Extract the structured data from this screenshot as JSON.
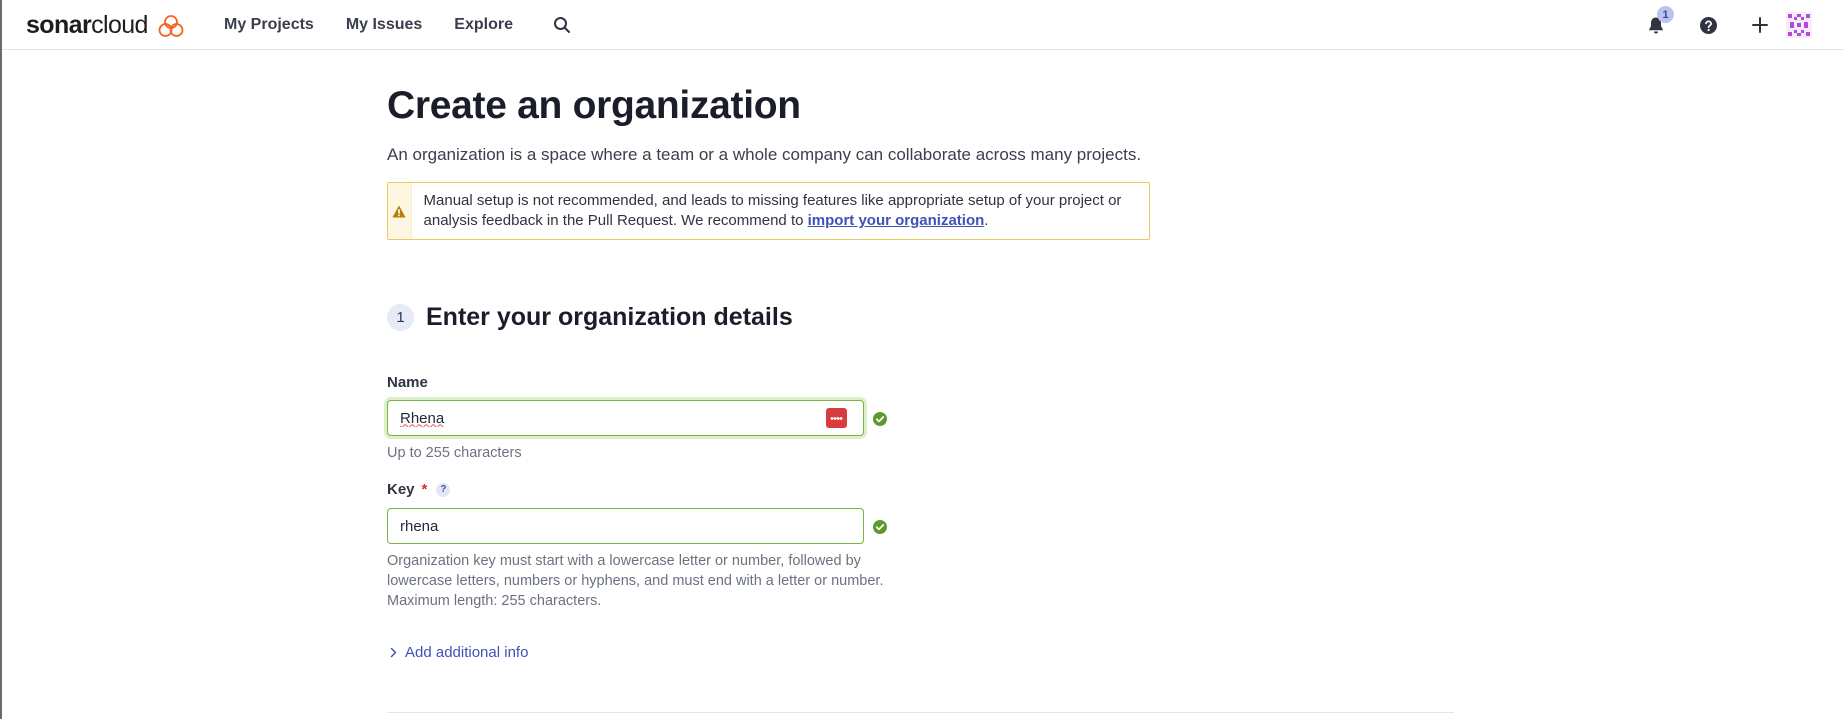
{
  "header": {
    "logo_bold": "sonar",
    "logo_light": "cloud",
    "nav": [
      "My Projects",
      "My Issues",
      "Explore"
    ],
    "notification_count": "1",
    "icons": [
      "search-icon",
      "bell-icon",
      "help-icon",
      "plus-icon",
      "avatar"
    ]
  },
  "page": {
    "title": "Create an organization",
    "description": "An organization is a space where a team or a whole company can collaborate across many projects.",
    "warning": {
      "text_before": "Manual setup is not recommended, and leads to missing features like appropriate setup of your project or analysis feedback in the Pull Request. We recommend to ",
      "link": "import your organization",
      "text_after": "."
    }
  },
  "step": {
    "number": "1",
    "title": "Enter your organization details"
  },
  "form": {
    "name_label": "Name",
    "name_value": "Rhena",
    "name_hint": "Up to 255 characters",
    "key_label": "Key",
    "key_required": "*",
    "key_help": "?",
    "key_value": "rhena",
    "key_hint": "Organization key must start with a lowercase letter or number, followed by lowercase letters, numbers or hyphens, and must end with a letter or number. Maximum length: 255 characters.",
    "add_info": "Add additional info"
  },
  "colors": {
    "accent": "#3e52b8",
    "valid": "#7cb342",
    "warning_border": "#f1c75f",
    "required": "#d02f3a"
  }
}
